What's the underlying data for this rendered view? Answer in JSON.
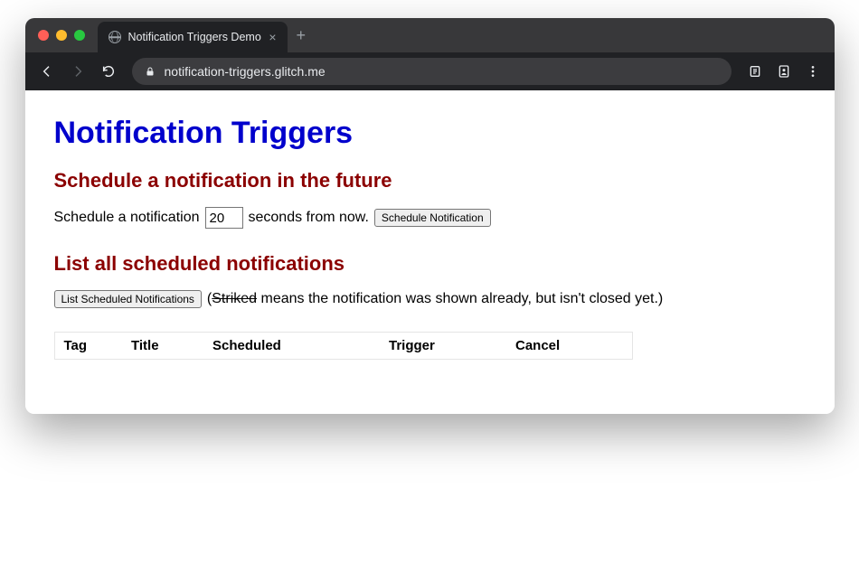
{
  "browser": {
    "tab_title": "Notification Triggers Demo",
    "url": "notification-triggers.glitch.me"
  },
  "page": {
    "heading": "Notification Triggers",
    "schedule_section": {
      "heading": "Schedule a notification in the future",
      "prefix_text": "Schedule a notification",
      "seconds_value": "20",
      "suffix_text": "seconds from now.",
      "button_label": "Schedule Notification"
    },
    "list_section": {
      "heading": "List all scheduled notifications",
      "button_label": "List Scheduled Notifications",
      "hint_open": "(",
      "hint_strike": "Striked",
      "hint_rest": " means the notification was shown already, but isn't closed yet.)",
      "columns": [
        "Tag",
        "Title",
        "Scheduled",
        "Trigger",
        "Cancel"
      ]
    }
  }
}
